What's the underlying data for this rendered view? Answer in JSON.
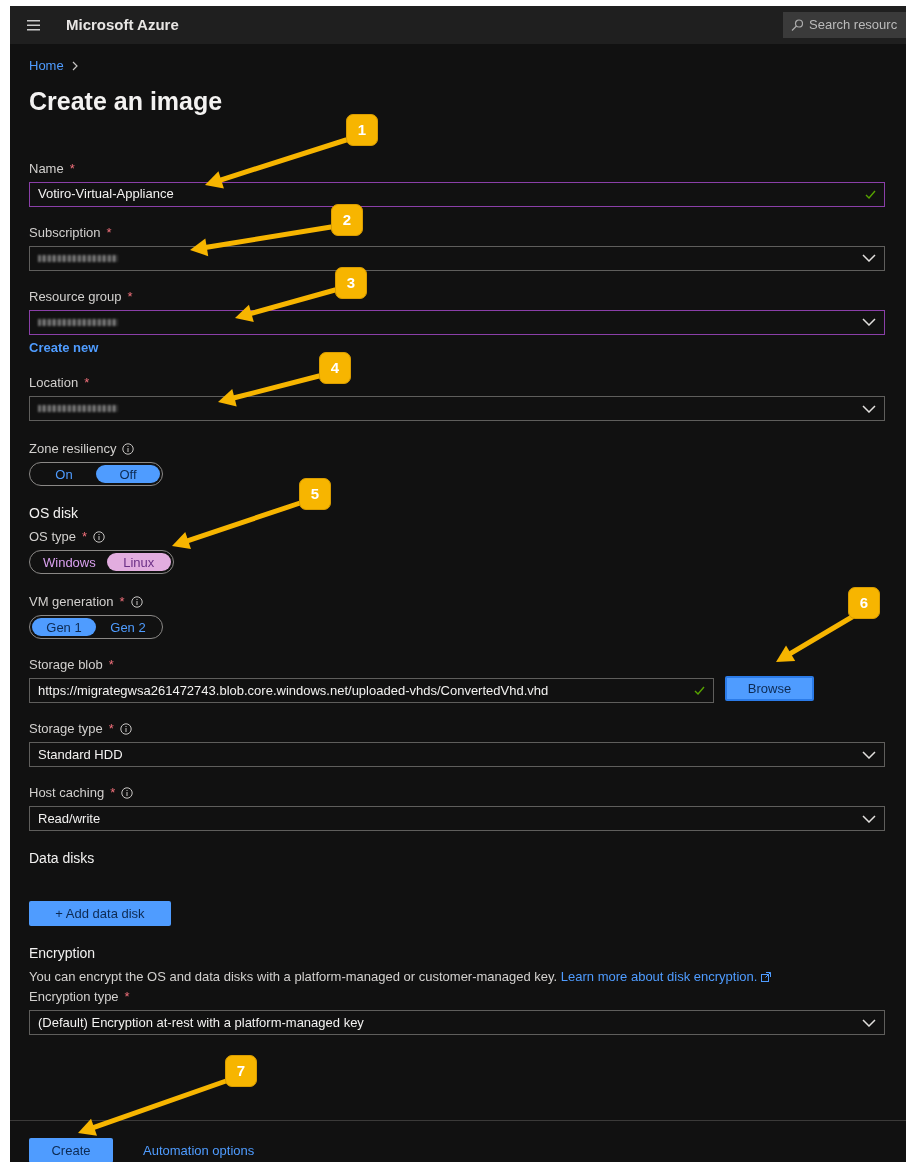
{
  "topbar": {
    "title": "Microsoft Azure",
    "search": {
      "placeholder": "Search resourc"
    }
  },
  "breadcrumb": [
    {
      "label": "Home"
    }
  ],
  "page_title": "Create an image",
  "fields": [
    {
      "kind": "text",
      "label": "Name",
      "required_mark": "*",
      "value": "Votiro-Virtual-Appliance",
      "valid": true,
      "focused": true
    },
    {
      "kind": "select",
      "label": "Subscription",
      "required_mark": "*",
      "redacted": true
    },
    {
      "kind": "select",
      "label": "Resource group",
      "required_mark": "*",
      "redacted": true,
      "focused": true,
      "link": "Create new"
    },
    {
      "kind": "select",
      "label": "Location",
      "required_mark": "*",
      "redacted": true
    },
    {
      "kind": "toggle",
      "label": "Zone resiliency",
      "info": true,
      "options": [
        {
          "label": "On",
          "selected": false
        },
        {
          "label": "Off",
          "selected": true
        }
      ]
    },
    {
      "kind": "heading",
      "label": "OS disk"
    },
    {
      "kind": "toggle",
      "label": "OS type",
      "required_mark": "*",
      "info": true,
      "focused": true,
      "options": [
        {
          "label": "Windows",
          "selected": false
        },
        {
          "label": "Linux",
          "selected": true
        }
      ]
    },
    {
      "kind": "toggle",
      "label": "VM generation",
      "required_mark": "*",
      "info": true,
      "options": [
        {
          "label": "Gen 1",
          "selected": true
        },
        {
          "label": "Gen 2",
          "selected": false
        }
      ]
    },
    {
      "kind": "text",
      "label": "Storage blob",
      "required_mark": "*",
      "value": "https://migrategwsa261472743.blob.core.windows.net/uploaded-vhds/ConvertedVhd.vhd",
      "valid": true,
      "button": "Browse"
    },
    {
      "kind": "select",
      "label": "Storage type",
      "required_mark": "*",
      "info": true,
      "value": "Standard HDD"
    },
    {
      "kind": "select",
      "label": "Host caching",
      "required_mark": "*",
      "info": true,
      "value": "Read/write"
    },
    {
      "kind": "heading",
      "label": "Data disks"
    },
    {
      "kind": "button",
      "label": "+ Add data disk"
    },
    {
      "kind": "heading",
      "label": "Encryption"
    },
    {
      "kind": "note",
      "text": "You can encrypt the OS and data disks with a platform-managed or customer-managed key.",
      "link": "Learn more about disk encryption."
    },
    {
      "kind": "select",
      "label": "Encryption type",
      "required_mark": "*",
      "value": "(Default) Encryption at-rest with a platform-managed key"
    }
  ],
  "footer": {
    "buttons": [
      {
        "label": "Create",
        "kind": "primary"
      },
      {
        "label": "Automation options",
        "kind": "link"
      }
    ]
  },
  "annotations": [
    {
      "label": "1"
    },
    {
      "label": "2"
    },
    {
      "label": "3"
    },
    {
      "label": "4"
    },
    {
      "label": "5"
    },
    {
      "label": "6"
    },
    {
      "label": "7"
    }
  ]
}
